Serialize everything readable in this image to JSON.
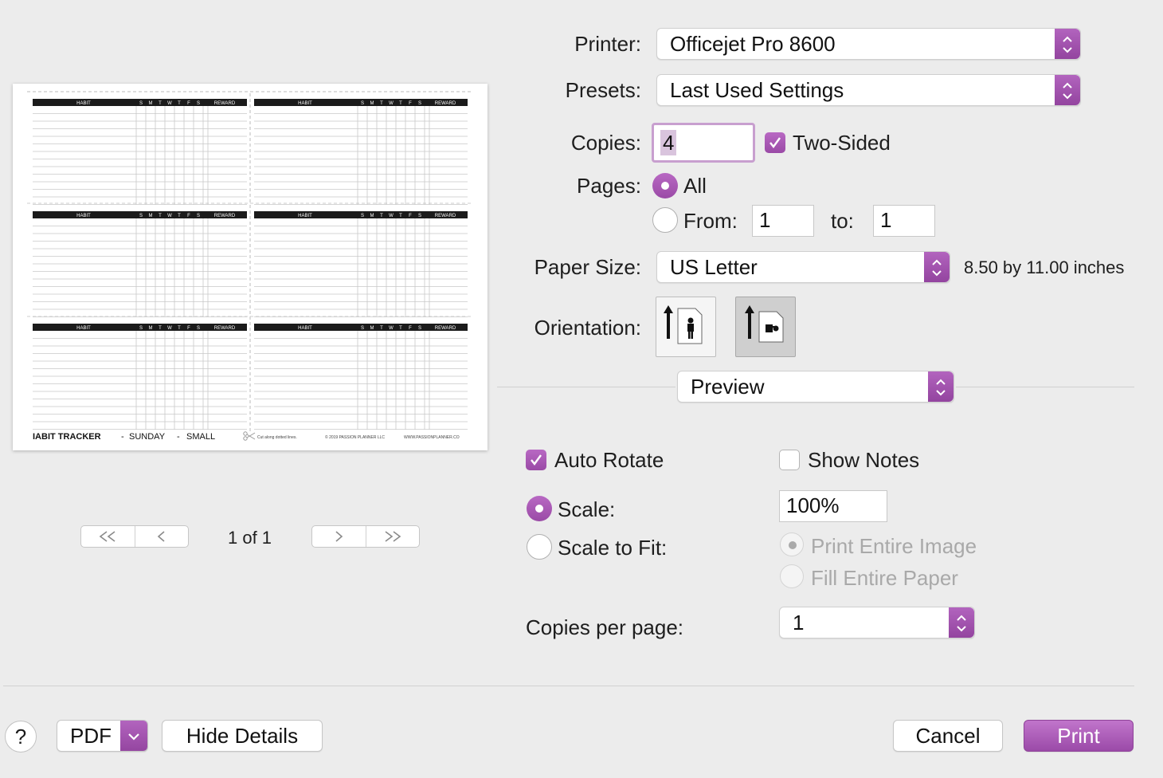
{
  "printer": {
    "label": "Printer:",
    "value": "Officejet Pro 8600"
  },
  "presets": {
    "label": "Presets:",
    "value": "Last Used Settings"
  },
  "copies": {
    "label": "Copies:",
    "value": "4",
    "two_sided_label": "Two-Sided",
    "two_sided_checked": true
  },
  "pages": {
    "label": "Pages:",
    "all_label": "All",
    "from_label": "From:",
    "from_value": "1",
    "to_label": "to:",
    "to_value": "1",
    "selected": "All"
  },
  "paper_size": {
    "label": "Paper Size:",
    "value": "US Letter",
    "dimensions": "8.50 by 11.00 inches"
  },
  "orientation": {
    "label": "Orientation:",
    "selected": "landscape"
  },
  "section_popup": {
    "value": "Preview"
  },
  "preview_options": {
    "auto_rotate_label": "Auto Rotate",
    "auto_rotate_checked": true,
    "show_notes_label": "Show Notes",
    "show_notes_checked": false,
    "scale_label": "Scale:",
    "scale_value": "100%",
    "scale_to_fit_label": "Scale to Fit:",
    "print_entire_image_label": "Print Entire Image",
    "fill_entire_paper_label": "Fill Entire Paper",
    "copies_per_page_label": "Copies per page:",
    "copies_per_page_value": "1"
  },
  "page_nav": {
    "indicator": "1 of 1"
  },
  "preview_sheet": {
    "header_habit": "HABIT",
    "header_days": [
      "S",
      "M",
      "T",
      "W",
      "T",
      "F",
      "S"
    ],
    "header_reward": "REWARD",
    "footer_title": "IABIT TRACKER",
    "footer_sep": "-",
    "footer_day": "SUNDAY",
    "footer_size": "SMALL",
    "footer_cut": "Cut along dotted lines.",
    "footer_copyright": "© 2019 PASSION PLANNER LLC",
    "footer_url": "WWW.PASSIONPLANNER.CO"
  },
  "bottom_bar": {
    "help_label": "?",
    "pdf_label": "PDF",
    "hide_details_label": "Hide Details",
    "cancel_label": "Cancel",
    "print_label": "Print"
  },
  "colors": {
    "accent": "#a452b0",
    "accent_dark": "#93449f",
    "background": "#ececec"
  }
}
